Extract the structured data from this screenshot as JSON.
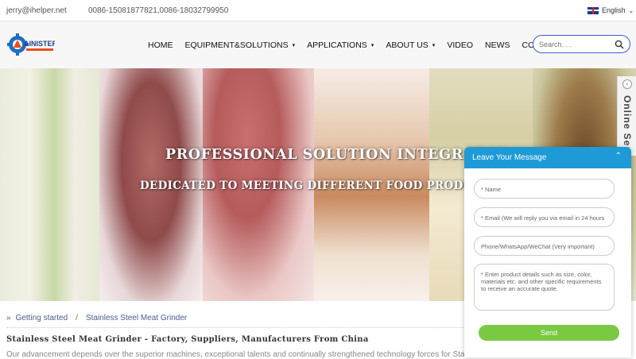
{
  "topbar": {
    "email": "jerry@ihelper.net",
    "phone": "0086-15081877821,0086-18032799950",
    "language": "English"
  },
  "header": {
    "logo_text": "AINISTER",
    "nav": [
      {
        "label": "HOME",
        "dropdown": false
      },
      {
        "label": "EQUIPMENT&SOLUTIONS",
        "dropdown": true
      },
      {
        "label": "APPLICATIONS",
        "dropdown": true
      },
      {
        "label": "ABOUT US",
        "dropdown": true
      },
      {
        "label": "VIDEO",
        "dropdown": false
      },
      {
        "label": "NEWS",
        "dropdown": false
      },
      {
        "label": "CONTACT US",
        "dropdown": false
      }
    ],
    "search_placeholder": "Search. . ."
  },
  "banner": {
    "title": "PROFESSIONAL SOLUTION INTEGRATOR",
    "subtitle": "DEDICATED TO MEETING DIFFERENT FOOD PRODUCTION N"
  },
  "online_service": {
    "label": "Online Ser"
  },
  "breadcrumb": {
    "home": "Getting started",
    "separator": "/",
    "current": "Stainless Steel Meat Grinder"
  },
  "page": {
    "title": "Stainless Steel Meat Grinder - Factory, Suppliers, Manufacturers From China",
    "intro": "Our advancement depends over the superior machines, exceptional talents and continually strengthened technology forces for Stain"
  },
  "message_form": {
    "title": "Leave Your Message",
    "name_placeholder": "* Name",
    "email_placeholder": "* Email (We will reply you via email in 24 hours",
    "phone_placeholder": "Phone/WhatsApp/WeChat (Very important)",
    "details_placeholder": "* Enter product details such as size, color, materials etc. and other specific requirements to receive an accurate quote.",
    "send_label": "Send"
  },
  "colors": {
    "accent": "#1e9bd7",
    "search_border": "#3a5bd9",
    "send": "#7ac943"
  }
}
